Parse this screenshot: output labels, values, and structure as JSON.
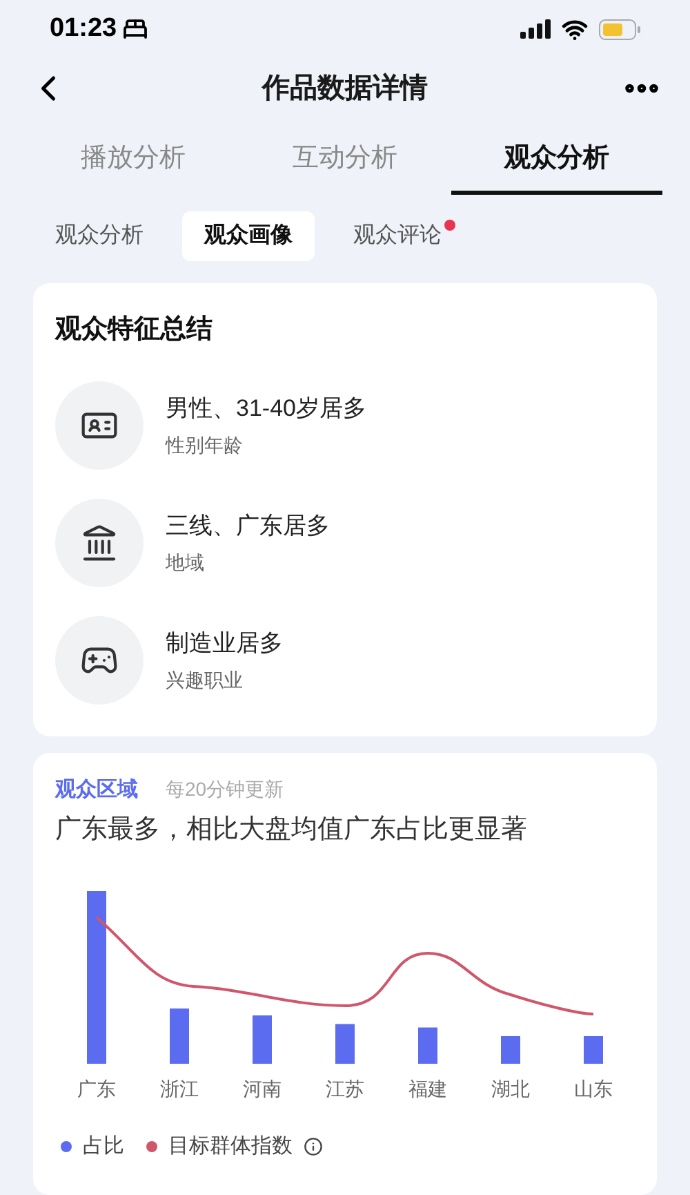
{
  "status_bar": {
    "time": "01:23"
  },
  "nav": {
    "title": "作品数据详情"
  },
  "tabs": [
    {
      "label": "播放分析",
      "selected": false
    },
    {
      "label": "互动分析",
      "selected": false
    },
    {
      "label": "观众分析",
      "selected": true
    }
  ],
  "sub_tabs": [
    {
      "label": "观众分析",
      "selected": false,
      "dot": false
    },
    {
      "label": "观众画像",
      "selected": true,
      "dot": false
    },
    {
      "label": "观众评论",
      "selected": false,
      "dot": true
    }
  ],
  "summary": {
    "title": "观众特征总结",
    "items": [
      {
        "kind": "id-card",
        "value": "男性、31-40岁居多",
        "label": "性别年龄"
      },
      {
        "kind": "building",
        "value": "三线、广东居多",
        "label": "地域"
      },
      {
        "kind": "gamepad",
        "value": "制造业居多",
        "label": "兴趣职业"
      }
    ]
  },
  "region": {
    "title": "观众区域",
    "update_note": "每20分钟更新",
    "headline": "广东最多，相比大盘均值广东占比更显著",
    "x_labels": [
      "广东",
      "浙江",
      "河南",
      "江苏",
      "福建",
      "湖北",
      "山东"
    ],
    "legend": [
      {
        "label": "占比",
        "color": "#5b6cf0"
      },
      {
        "label": "目标群体指数",
        "color": "#d0566c",
        "info": true
      }
    ]
  }
}
